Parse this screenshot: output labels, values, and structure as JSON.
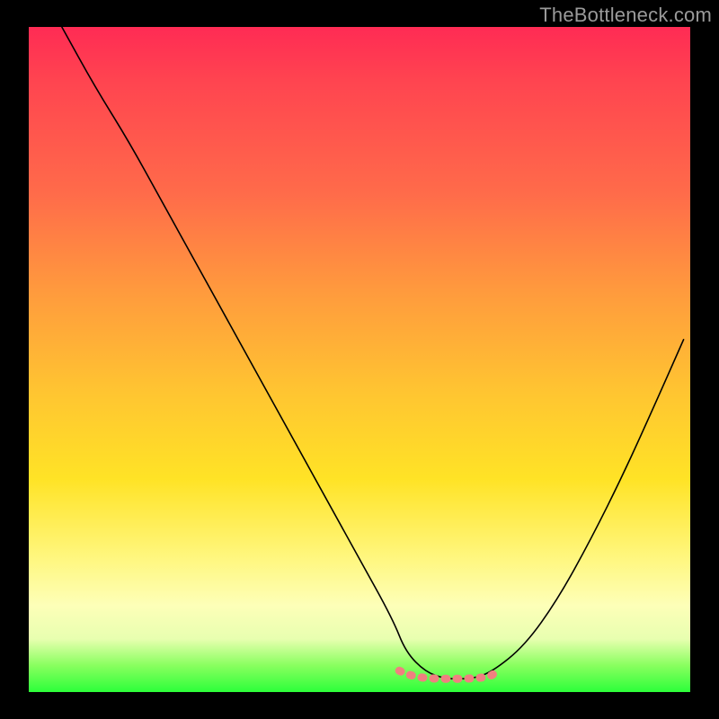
{
  "watermark": {
    "text": "TheBottleneck.com"
  },
  "chart_data": {
    "type": "line",
    "title": "",
    "xlabel": "",
    "ylabel": "",
    "xlim": [
      0,
      100
    ],
    "ylim": [
      0,
      100
    ],
    "grid": false,
    "legend": false,
    "series": [
      {
        "name": "bottleneck-curve",
        "x": [
          5,
          10,
          15,
          20,
          25,
          30,
          35,
          40,
          45,
          50,
          55,
          57,
          60,
          63,
          65,
          67,
          70,
          75,
          80,
          85,
          90,
          95,
          99
        ],
        "values": [
          100,
          91,
          83,
          74,
          65,
          56,
          47,
          38,
          29,
          20,
          11,
          6,
          3,
          2,
          2,
          2,
          3,
          7,
          14,
          23,
          33,
          44,
          53
        ],
        "color": "#000000"
      },
      {
        "name": "flat-marker",
        "x": [
          56,
          58,
          60,
          62,
          64,
          66,
          68,
          70,
          71
        ],
        "values": [
          3.2,
          2.4,
          2.1,
          2.0,
          2.0,
          2.0,
          2.1,
          2.4,
          3.4
        ],
        "color": "#f08080",
        "style": "dotted-thick"
      }
    ],
    "gradient_stops": [
      {
        "pos": 0,
        "color": "#ff2b54"
      },
      {
        "pos": 25,
        "color": "#ff6b4a"
      },
      {
        "pos": 55,
        "color": "#ffc531"
      },
      {
        "pos": 80,
        "color": "#fff780"
      },
      {
        "pos": 96,
        "color": "#89ff5f"
      },
      {
        "pos": 100,
        "color": "#2cff3a"
      }
    ]
  }
}
